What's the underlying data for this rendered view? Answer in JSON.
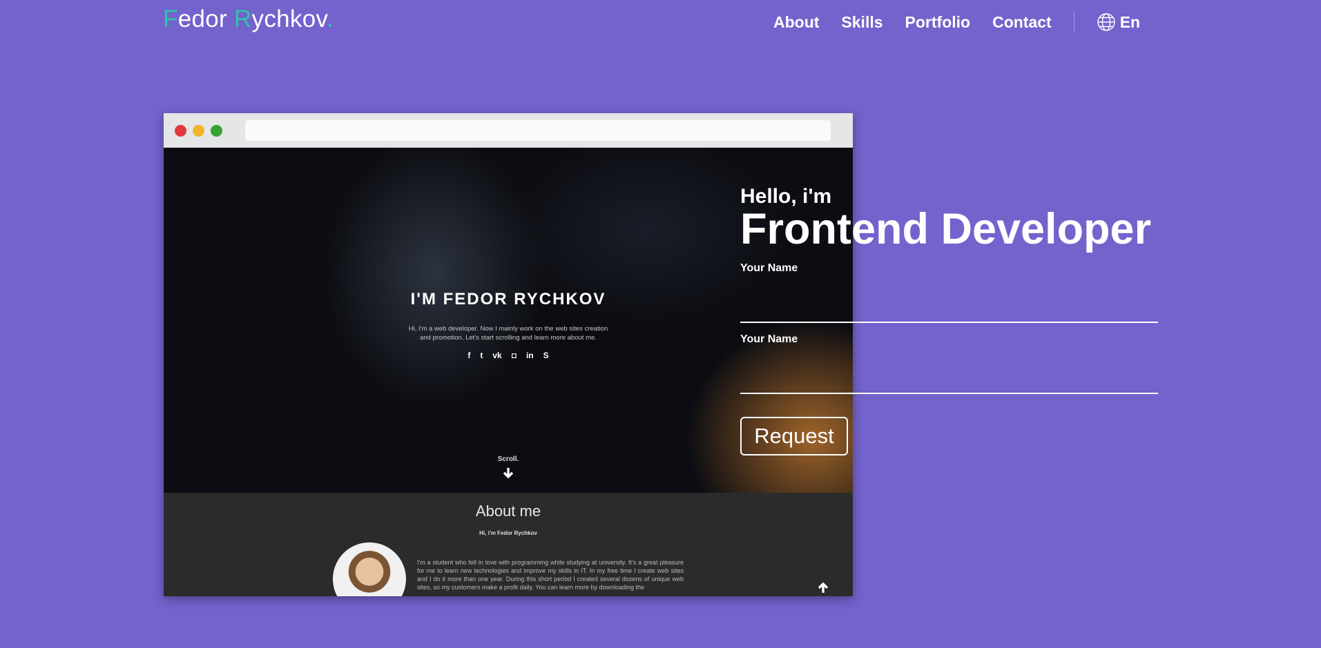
{
  "header": {
    "logo": {
      "first_initial": "F",
      "first_rest": "edor ",
      "last_initial": "R",
      "last_rest": "ychkov",
      "dot": "."
    },
    "nav": [
      "About",
      "Skills",
      "Portfolio",
      "Contact"
    ],
    "language": "En"
  },
  "mockup": {
    "hero_title": "I'M FEDOR RYCHKOV",
    "hero_subtitle": "Hi, I'm a web developer. Now I mainly work on the web sites creation and promotion. Let's start scrolling and learn more about me.",
    "social_icons": [
      "facebook-icon",
      "twitter-icon",
      "vk-icon",
      "instagram-icon",
      "linkedin-icon",
      "skype-icon"
    ],
    "social_glyphs": [
      "f",
      "t",
      "vk",
      "◘",
      "in",
      "S"
    ],
    "scroll_label": "Scroll.",
    "about_title": "About me",
    "about_subtitle": "Hi, i'm Fedor Rychkov",
    "about_text": "I'm a student who fell in love with programming while studying at university. It's a great pleasure for me to learn new technologies and improve my skills in IT. In my free time I create web sites and I do it more than one year. During this short period I created several dozens of unique web sites, so my customers make a profit daily. You can learn more by downloading the"
  },
  "hero": {
    "greeting": "Hello, i'm",
    "role": "Frontend Developer"
  },
  "form": {
    "fields": [
      {
        "label": "Your Name",
        "value": ""
      },
      {
        "label": "Your Name",
        "value": ""
      }
    ],
    "submit_label": "Request"
  },
  "colors": {
    "background": "#7462cd",
    "accent": "#2fc4a8",
    "window_close": "#e0393b",
    "window_minimize": "#f0b429",
    "window_maximize": "#3aa230"
  }
}
